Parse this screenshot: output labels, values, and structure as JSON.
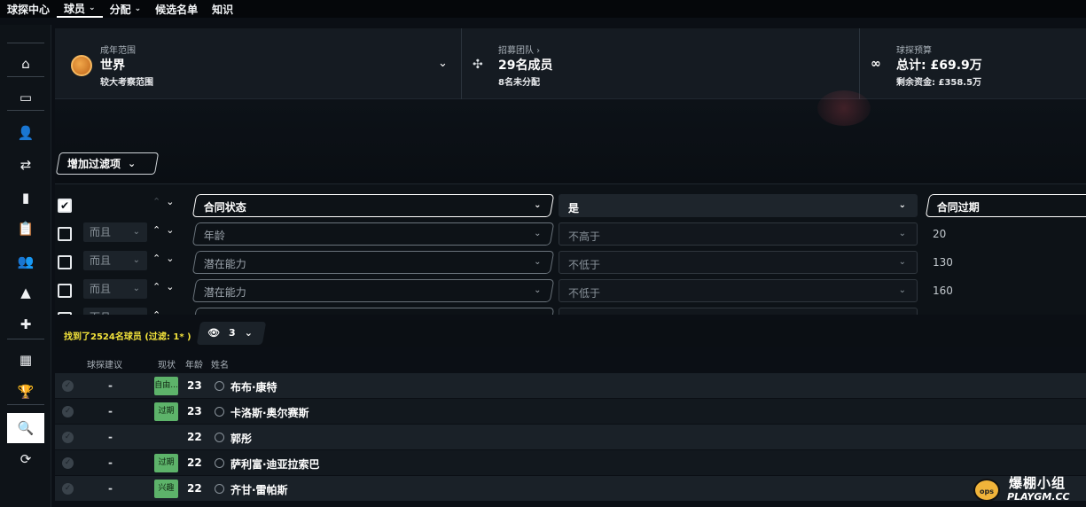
{
  "topnav": {
    "items": [
      {
        "label": "球探中心",
        "has_caret": false,
        "active": false
      },
      {
        "label": "球员",
        "has_caret": true,
        "active": true
      },
      {
        "label": "分配",
        "has_caret": true,
        "active": false
      },
      {
        "label": "候选名单",
        "has_caret": false,
        "active": false
      },
      {
        "label": "知识",
        "has_caret": false,
        "active": false
      }
    ],
    "caret": "⌄"
  },
  "sidebar": {
    "icons": [
      {
        "name": "home-icon",
        "glyph": "⌂"
      },
      {
        "name": "inbox-icon",
        "glyph": "▭"
      },
      {
        "name": "squad-icon",
        "glyph": "👤"
      },
      {
        "name": "transfers-icon",
        "glyph": "⇄"
      },
      {
        "name": "tactics-icon",
        "glyph": "▮"
      },
      {
        "name": "clipboard-icon",
        "glyph": "📋"
      },
      {
        "name": "staff-icon",
        "glyph": "👥"
      },
      {
        "name": "training-icon",
        "glyph": "▲"
      },
      {
        "name": "medical-icon",
        "glyph": "✚"
      },
      {
        "name": "calendar-icon",
        "glyph": "▦"
      },
      {
        "name": "trophy-icon",
        "glyph": "🏆"
      },
      {
        "name": "search-icon",
        "glyph": "🔍",
        "active": true
      },
      {
        "name": "refresh-icon",
        "glyph": "⟳"
      }
    ]
  },
  "header": {
    "range": {
      "caption": "成年范围",
      "title": "世界",
      "subtitle": "较大考察范围",
      "caret": "⌄"
    },
    "team": {
      "caption": "招募团队 ›",
      "title": "29名成员",
      "subtitle": "8名未分配",
      "icon": "people-icon"
    },
    "budget": {
      "caption": "球探预算",
      "title": "总计: £69.9万",
      "subtitle": "剩余资金: £358.5万",
      "icon": "binoculars-icon"
    }
  },
  "add_filter": {
    "label": "增加过滤项",
    "caret": "⌄"
  },
  "filters": [
    {
      "checked": true,
      "conj": "",
      "field": "合同状态",
      "op": "是",
      "value": "合同过期",
      "up": "⌃",
      "down": "⌄"
    },
    {
      "checked": false,
      "conj": "而且",
      "field": "年龄",
      "op": "不高于",
      "value": "20",
      "up": "⌃",
      "down": "⌄"
    },
    {
      "checked": false,
      "conj": "而且",
      "field": "潜在能力",
      "op": "不低于",
      "value": "130",
      "up": "⌃",
      "down": "⌄"
    },
    {
      "checked": false,
      "conj": "而且",
      "field": "潜在能力",
      "op": "不低于",
      "value": "160",
      "up": "⌃",
      "down": "⌄"
    },
    {
      "checked": false,
      "conj": "而且",
      "field": "潜在能力",
      "op": "不低于",
      "value": "",
      "up": "⌃",
      "down": "⌄"
    }
  ],
  "results": {
    "summary": "找到了2524名球员 (过滤: 1* )",
    "view_count": "3",
    "view_icon": "eye-icon",
    "caret": "⌄"
  },
  "table": {
    "headers": {
      "rec": "球探建议",
      "status": "现状",
      "age": "年龄",
      "name": "姓名"
    },
    "rows": [
      {
        "rec": "-",
        "status": "自由...",
        "age": "23",
        "name": "布布·康特"
      },
      {
        "rec": "-",
        "status": "过期",
        "age": "23",
        "name": "卡洛斯·奥尔赛斯"
      },
      {
        "rec": "-",
        "status": "",
        "age": "22",
        "name": "郭彤"
      },
      {
        "rec": "-",
        "status": "过期",
        "age": "22",
        "name": "萨利富·迪亚拉索巴"
      },
      {
        "rec": "-",
        "status": "兴趣",
        "age": "22",
        "name": "齐甘·雷帕斯"
      }
    ]
  },
  "watermark": {
    "cn": "爆棚小组",
    "en": "PLAYGM.CC",
    "ball": "ops"
  },
  "colors": {
    "accent_yellow": "#f2e23b",
    "badge_green": "#5db36a",
    "background": "#0b0f15"
  }
}
